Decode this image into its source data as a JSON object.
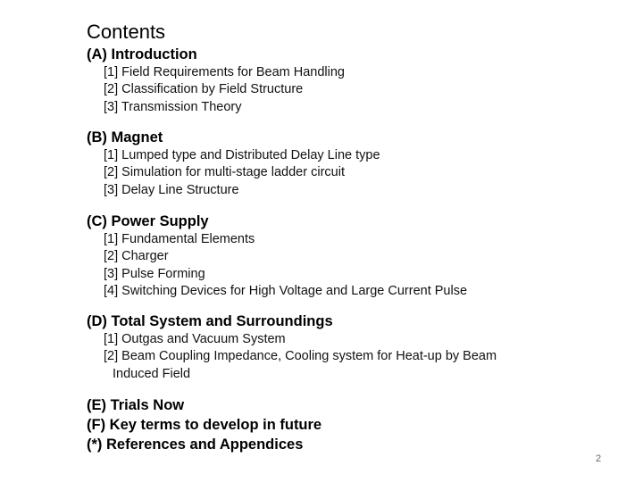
{
  "title": "Contents",
  "sections": [
    {
      "heading": "(A) Introduction",
      "items": [
        "[1] Field Requirements for Beam Handling",
        "[2] Classification by Field Structure",
        "[3] Transmission Theory"
      ]
    },
    {
      "heading": "(B) Magnet",
      "items": [
        "[1] Lumped type and Distributed Delay Line type",
        "[2] Simulation for multi-stage ladder circuit",
        "[3] Delay Line Structure"
      ]
    },
    {
      "heading": "(C) Power Supply",
      "items": [
        "[1] Fundamental Elements",
        "[2] Charger",
        "[3] Pulse Forming",
        "[4] Switching Devices for High Voltage and Large Current Pulse"
      ]
    },
    {
      "heading": "(D) Total System and Surroundings",
      "items": [
        "[1] Outgas and Vacuum System",
        "[2] Beam Coupling Impedance, Cooling system for Heat-up by Beam",
        "Induced Field"
      ]
    }
  ],
  "trailing": [
    "(E) Trials Now",
    "(F) Key terms to develop in future",
    "(*) References and Appendices"
  ],
  "page_number": "2"
}
